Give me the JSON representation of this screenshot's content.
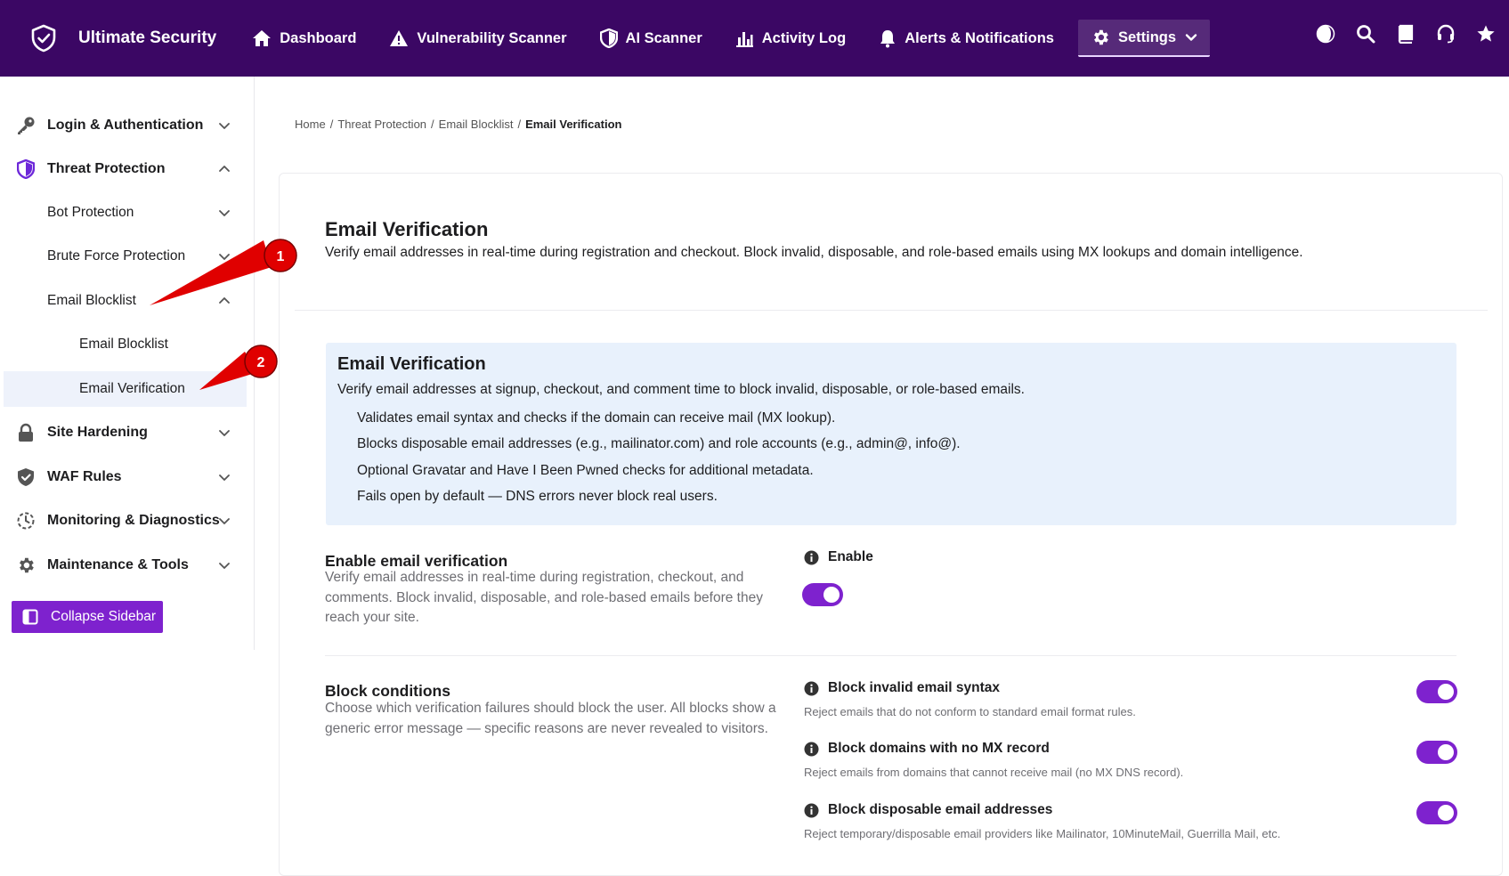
{
  "app": {
    "name": "Ultimate Security"
  },
  "nav": {
    "items": [
      {
        "label": "Dashboard"
      },
      {
        "label": "Vulnerability Scanner"
      },
      {
        "label": "AI Scanner"
      },
      {
        "label": "Activity Log"
      },
      {
        "label": "Alerts & Notifications"
      },
      {
        "label": "Settings"
      }
    ]
  },
  "sidebar": {
    "items": [
      {
        "label": "Login & Authentication"
      },
      {
        "label": "Threat Protection"
      },
      {
        "label": "Bot Protection"
      },
      {
        "label": "Brute Force Protection"
      },
      {
        "label": "Email Blocklist"
      },
      {
        "label": "Email Blocklist"
      },
      {
        "label": "Email Verification"
      },
      {
        "label": "Site Hardening"
      },
      {
        "label": "WAF Rules"
      },
      {
        "label": "Monitoring & Diagnostics"
      },
      {
        "label": "Maintenance & Tools"
      }
    ],
    "collapse_label": "Collapse Sidebar"
  },
  "breadcrumb": {
    "items": [
      "Home",
      "Threat Protection",
      "Email Blocklist"
    ],
    "separator": "/",
    "current": "Email Verification"
  },
  "page": {
    "title": "Email Verification",
    "description": "Verify email addresses in real-time during registration and checkout. Block invalid, disposable, and role-based emails using MX lookups and domain intelligence."
  },
  "infobox": {
    "title": "Email Verification",
    "description": "Verify email addresses at signup, checkout, and comment time to block invalid, disposable, or role-based emails.",
    "bullets": [
      "Validates email syntax and checks if the domain can receive mail (MX lookup).",
      "Blocks disposable email addresses (e.g., mailinator.com) and role accounts (e.g., admin@, info@).",
      "Optional Gravatar and Have I Been Pwned checks for additional metadata.",
      "Fails open by default — DNS errors never block real users."
    ]
  },
  "enable_section": {
    "title": "Enable email verification",
    "description": "Verify email addresses in real-time during registration, checkout, and comments. Block invalid, disposable, and role-based emails before they reach your site.",
    "option_label": "Enable",
    "enabled": true
  },
  "block_section": {
    "title": "Block conditions",
    "description": "Choose which verification failures should block the user. All blocks show a generic error message — specific reasons are never revealed to visitors.",
    "options": [
      {
        "label": "Block invalid email syntax",
        "description": "Reject emails that do not conform to standard email format rules.",
        "enabled": true
      },
      {
        "label": "Block domains with no MX record",
        "description": "Reject emails from domains that cannot receive mail (no MX DNS record).",
        "enabled": true
      },
      {
        "label": "Block disposable email addresses",
        "description": "Reject temporary/disposable email providers like Mailinator, 10MinuteMail, Guerrilla Mail, etc.",
        "enabled": true
      }
    ]
  },
  "callouts": [
    "1",
    "2"
  ],
  "colors": {
    "topbar": "#3b0764",
    "accent": "#7e22ce",
    "callout": "#e00000",
    "infobox": "#e8f1fc"
  }
}
